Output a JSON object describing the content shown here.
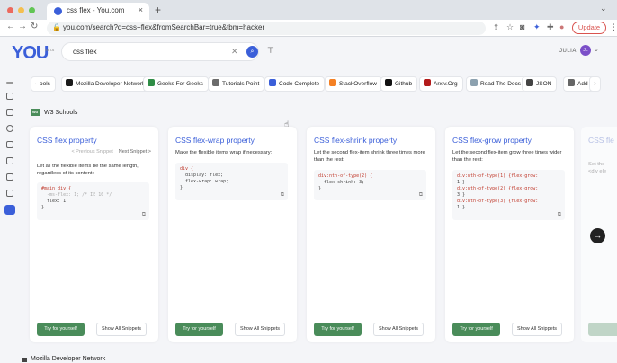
{
  "browser": {
    "tab_title": "css flex - You.com",
    "tab_close": "×",
    "new_tab": "+",
    "tab_list": "⌄",
    "nav": {
      "back": "←",
      "forward": "→",
      "reload": "↻"
    },
    "url": "you.com/search?q=css+flex&fromSearchBar=true&tbm=hacker",
    "update_label": "Update",
    "menu": "⋮"
  },
  "header": {
    "logo": "YOU",
    "logo_sub": "BETA",
    "search_value": "css flex",
    "clear": "✕",
    "search_button": "⌕",
    "filter": "⊤",
    "user_name": "JULIA",
    "user_initials": "JL",
    "user_chevron": "⌄"
  },
  "apps": {
    "prev": "‹",
    "next": "›",
    "items": [
      {
        "label": "ools",
        "icon": "tools-icon",
        "color": "#ffffff"
      },
      {
        "label": "Mozilla Developer Network",
        "icon": "mdn-icon",
        "color": "#1b1b1b"
      },
      {
        "label": "Geeks For Geeks",
        "icon": "gfg-icon",
        "color": "#2f8d46"
      },
      {
        "label": "Tutorials Point",
        "icon": "tutorialspoint-icon",
        "color": "#6b6b6b"
      },
      {
        "label": "Code Complete",
        "icon": "codecomplete-icon",
        "color": "#3b5fd9"
      },
      {
        "label": "StackOverflow",
        "icon": "stackoverflow-icon",
        "color": "#f48024"
      },
      {
        "label": "Github",
        "icon": "github-icon",
        "color": "#111111"
      },
      {
        "label": "Arxiv.Org",
        "icon": "arxiv-icon",
        "color": "#b31b1b"
      },
      {
        "label": "Read The Docs",
        "icon": "readthedocs-icon",
        "color": "#8ca1af"
      },
      {
        "label": "JSON",
        "icon": "json-icon",
        "color": "#444444"
      },
      {
        "label": "Add a",
        "icon": "add-icon",
        "color": "#666666"
      }
    ]
  },
  "source": {
    "icon": "W3",
    "title": "W3 Schools"
  },
  "cards": [
    {
      "title": "CSS flex property",
      "prev": "< Previous Snippet",
      "next": "Next Snippet >",
      "desc": "Let all the flexible items be the same length, regardless of its content:",
      "code": [
        "#main div {",
        "  -ms-flex: 1; /* IE 10 */",
        "  flex: 1;",
        "}"
      ],
      "try": "Try for yourself",
      "all": "Show All Snippets"
    },
    {
      "title": "CSS flex-wrap property",
      "desc": "Make the flexible items wrap if necessary:",
      "code": [
        "div {",
        "  display: flex;",
        "  flex-wrap: wrap;",
        "}"
      ],
      "try": "Try for yourself",
      "all": "Show All Snippets"
    },
    {
      "title": "CSS flex-shrink property",
      "desc": "Let the second flex-item shrink three times more than the rest:",
      "code": [
        "div:nth-of-type(2) {",
        "  flex-shrink: 3;",
        "}"
      ],
      "try": "Try for yourself",
      "all": "Show All Snippets"
    },
    {
      "title": "CSS flex-grow property",
      "desc": "Let the second flex-item grow three times wider than the rest:",
      "code": [
        "div:nth-of-type(1) {flex-grow:",
        "1;}",
        "div:nth-of-type(2) {flex-grow:",
        "3;}",
        "div:nth-of-type(3) {flex-grow:",
        "1;}"
      ],
      "try": "Try for yourself",
      "all": "Show All Snippets"
    }
  ],
  "partial_card": {
    "title": "CSS fle",
    "desc_line1": "Set the",
    "desc_line2": "<div ele"
  },
  "next_arrow": "→",
  "next_source": "Mozilla Developer Network",
  "copy_glyph": "⧉"
}
